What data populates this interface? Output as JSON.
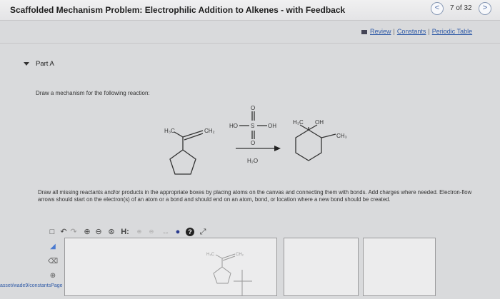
{
  "header": {
    "title": "Scaffolded Mechanism Problem: Electrophilic Addition to Alkenes - with Feedback",
    "page_count": "7 of 32",
    "prev_glyph": "<",
    "next_glyph": ">"
  },
  "links": {
    "review": "Review",
    "constants": "Constants",
    "periodic": "Periodic Table",
    "sep": "|"
  },
  "part": {
    "label": "Part A",
    "prompt": "Draw a mechanism for the following reaction:"
  },
  "reaction": {
    "reactant_h3c": "H₃C",
    "reactant_ch2": "CH₂",
    "reagent_ho": "HO",
    "reagent_s": "S",
    "reagent_oh": "OH",
    "reagent_o_top": "O",
    "reagent_o_bottom": "O",
    "solvent": "H₂O",
    "product_h3c": "H₃C",
    "product_oh": "OH",
    "product_ch3": "CH₃"
  },
  "instructions": "Draw all missing reactants and/or products in the appropriate boxes by placing atoms on the canvas and connecting them with bonds. Add charges where needed. Electron-flow arrows should start on the electron(s) of an atom or a bond and should end on an atom, bond, or location where a new bond should be created.",
  "toolbar": {
    "h_label": "H:"
  },
  "canvas_preview": {
    "h3c": "H₃C",
    "ch2": "CH₂"
  },
  "bottom_link": "asset/wade9/constantsPage",
  "colors": {
    "accent": "#2f5aa7",
    "canvas": "#ececed"
  }
}
